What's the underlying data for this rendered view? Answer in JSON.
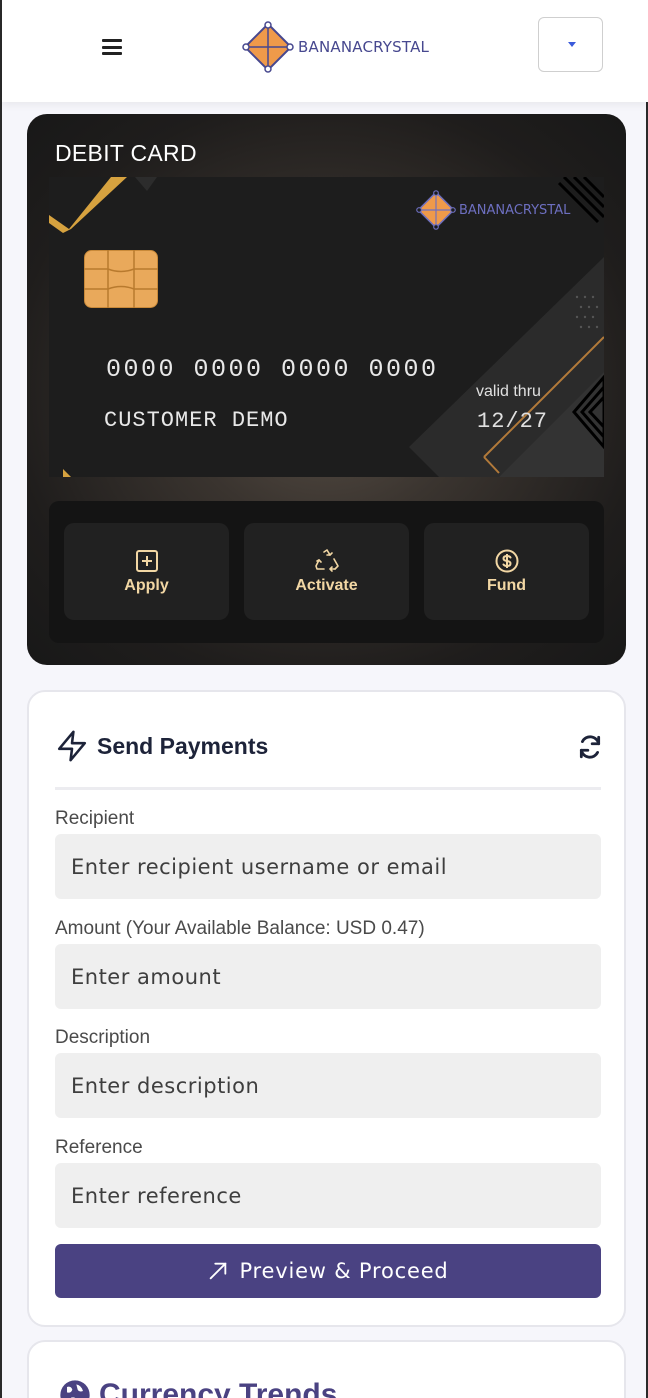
{
  "header": {
    "brand_name": "BANANACRYSTAL",
    "menu_icon": "hamburger-icon",
    "dropdown_icon": "caret-down-icon"
  },
  "debit_card": {
    "title": "DEBIT CARD",
    "brand_name": "BANANACRYSTAL",
    "card_number": "0000 0000 0000 0000",
    "holder_name": "CUSTOMER DEMO",
    "valid_label": "valid thru",
    "valid_date": "12/27",
    "actions": [
      {
        "label": "Apply",
        "icon": "plus-square-icon"
      },
      {
        "label": "Activate",
        "icon": "recycle-icon"
      },
      {
        "label": "Fund",
        "icon": "dollar-circle-icon"
      }
    ]
  },
  "send_payments": {
    "title": "Send Payments",
    "title_icon": "lightning-icon",
    "refresh_icon": "refresh-icon",
    "fields": [
      {
        "label": "Recipient",
        "placeholder": "Enter recipient username or email"
      },
      {
        "label": "Amount (Your Available Balance: USD 0.47)",
        "placeholder": "Enter amount"
      },
      {
        "label": "Description",
        "placeholder": "Enter description"
      },
      {
        "label": "Reference",
        "placeholder": "Enter reference"
      }
    ],
    "submit_label": "Preview & Proceed",
    "submit_icon": "arrow-up-right-icon"
  },
  "currency_trends": {
    "title": "Currency Trends",
    "icon": "globe-icon"
  },
  "colors": {
    "brand": "#47488f",
    "primary_button": "#4a4282",
    "action_label": "#f2d7a4",
    "brand_logo_orange": "#ef9a4a"
  }
}
